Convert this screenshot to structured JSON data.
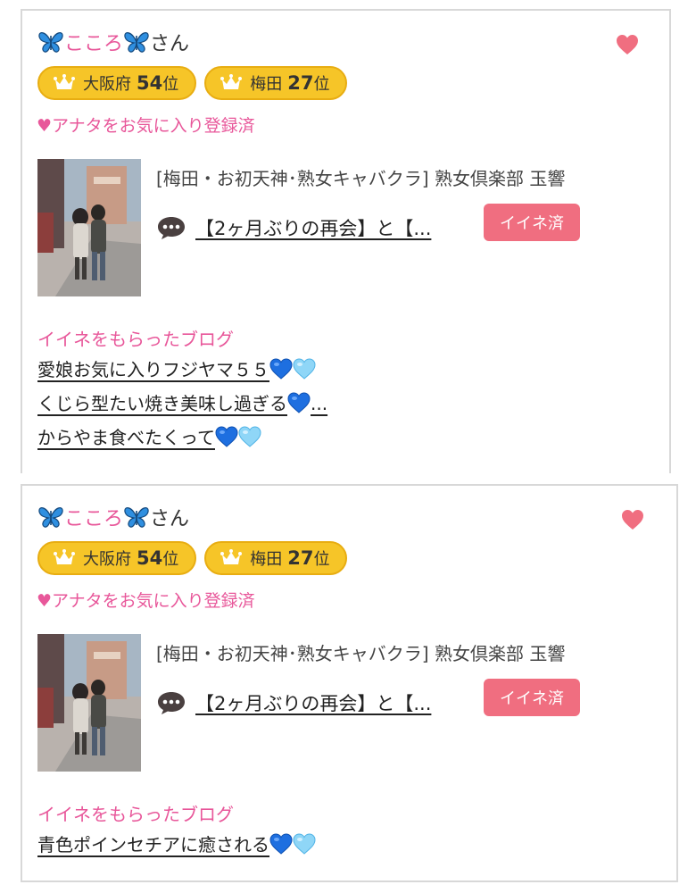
{
  "cards": [
    {
      "name": "こころ",
      "name_suffix": "さん",
      "badges": [
        {
          "label": "大阪府",
          "rank": "54",
          "suffix": "位"
        },
        {
          "label": "梅田",
          "rank": "27",
          "suffix": "位"
        }
      ],
      "favorite_text": "♥アナタをお気に入り登録済",
      "shop": "[梅田・お初天神･熟女キャバクラ]  熟女倶楽部 玉響",
      "blog_title": "【2ヶ月ぶりの再会】と【...",
      "like_button": "イイネ済",
      "liked_section_title": "イイネをもらったブログ",
      "liked_blogs": [
        {
          "text": "愛娘お気に入りフジヤマ５５",
          "hearts": [
            "blue-heart",
            "light-blue-heart"
          ],
          "ellipsis": ""
        },
        {
          "text": "くじら型たい焼き美味し過ぎる",
          "hearts": [
            "blue-heart"
          ],
          "ellipsis": "..."
        },
        {
          "text": "からやま食べたくって",
          "hearts": [
            "blue-heart",
            "light-blue-heart"
          ],
          "ellipsis": ""
        }
      ]
    },
    {
      "name": "こころ",
      "name_suffix": "さん",
      "badges": [
        {
          "label": "大阪府",
          "rank": "54",
          "suffix": "位"
        },
        {
          "label": "梅田",
          "rank": "27",
          "suffix": "位"
        }
      ],
      "favorite_text": "♥アナタをお気に入り登録済",
      "shop": "[梅田・お初天神･熟女キャバクラ]  熟女倶楽部 玉響",
      "blog_title": "【2ヶ月ぶりの再会】と【...",
      "like_button": "イイネ済",
      "liked_section_title": "イイネをもらったブログ",
      "liked_blogs": [
        {
          "text": "青色ポインセチアに癒される",
          "hearts": [
            "blue-heart",
            "light-blue-heart"
          ],
          "ellipsis": ""
        }
      ]
    }
  ],
  "colors": {
    "pink": "#e8579a",
    "heart": "#f06e80",
    "badge_gold": "#f6c528",
    "blue_heart": "#1e6fe0",
    "light_blue_heart": "#7fd0f5"
  },
  "icons": [
    "butterfly-icon",
    "heart-icon",
    "crown-icon",
    "speech-bubble-icon",
    "blue-heart-icon"
  ]
}
